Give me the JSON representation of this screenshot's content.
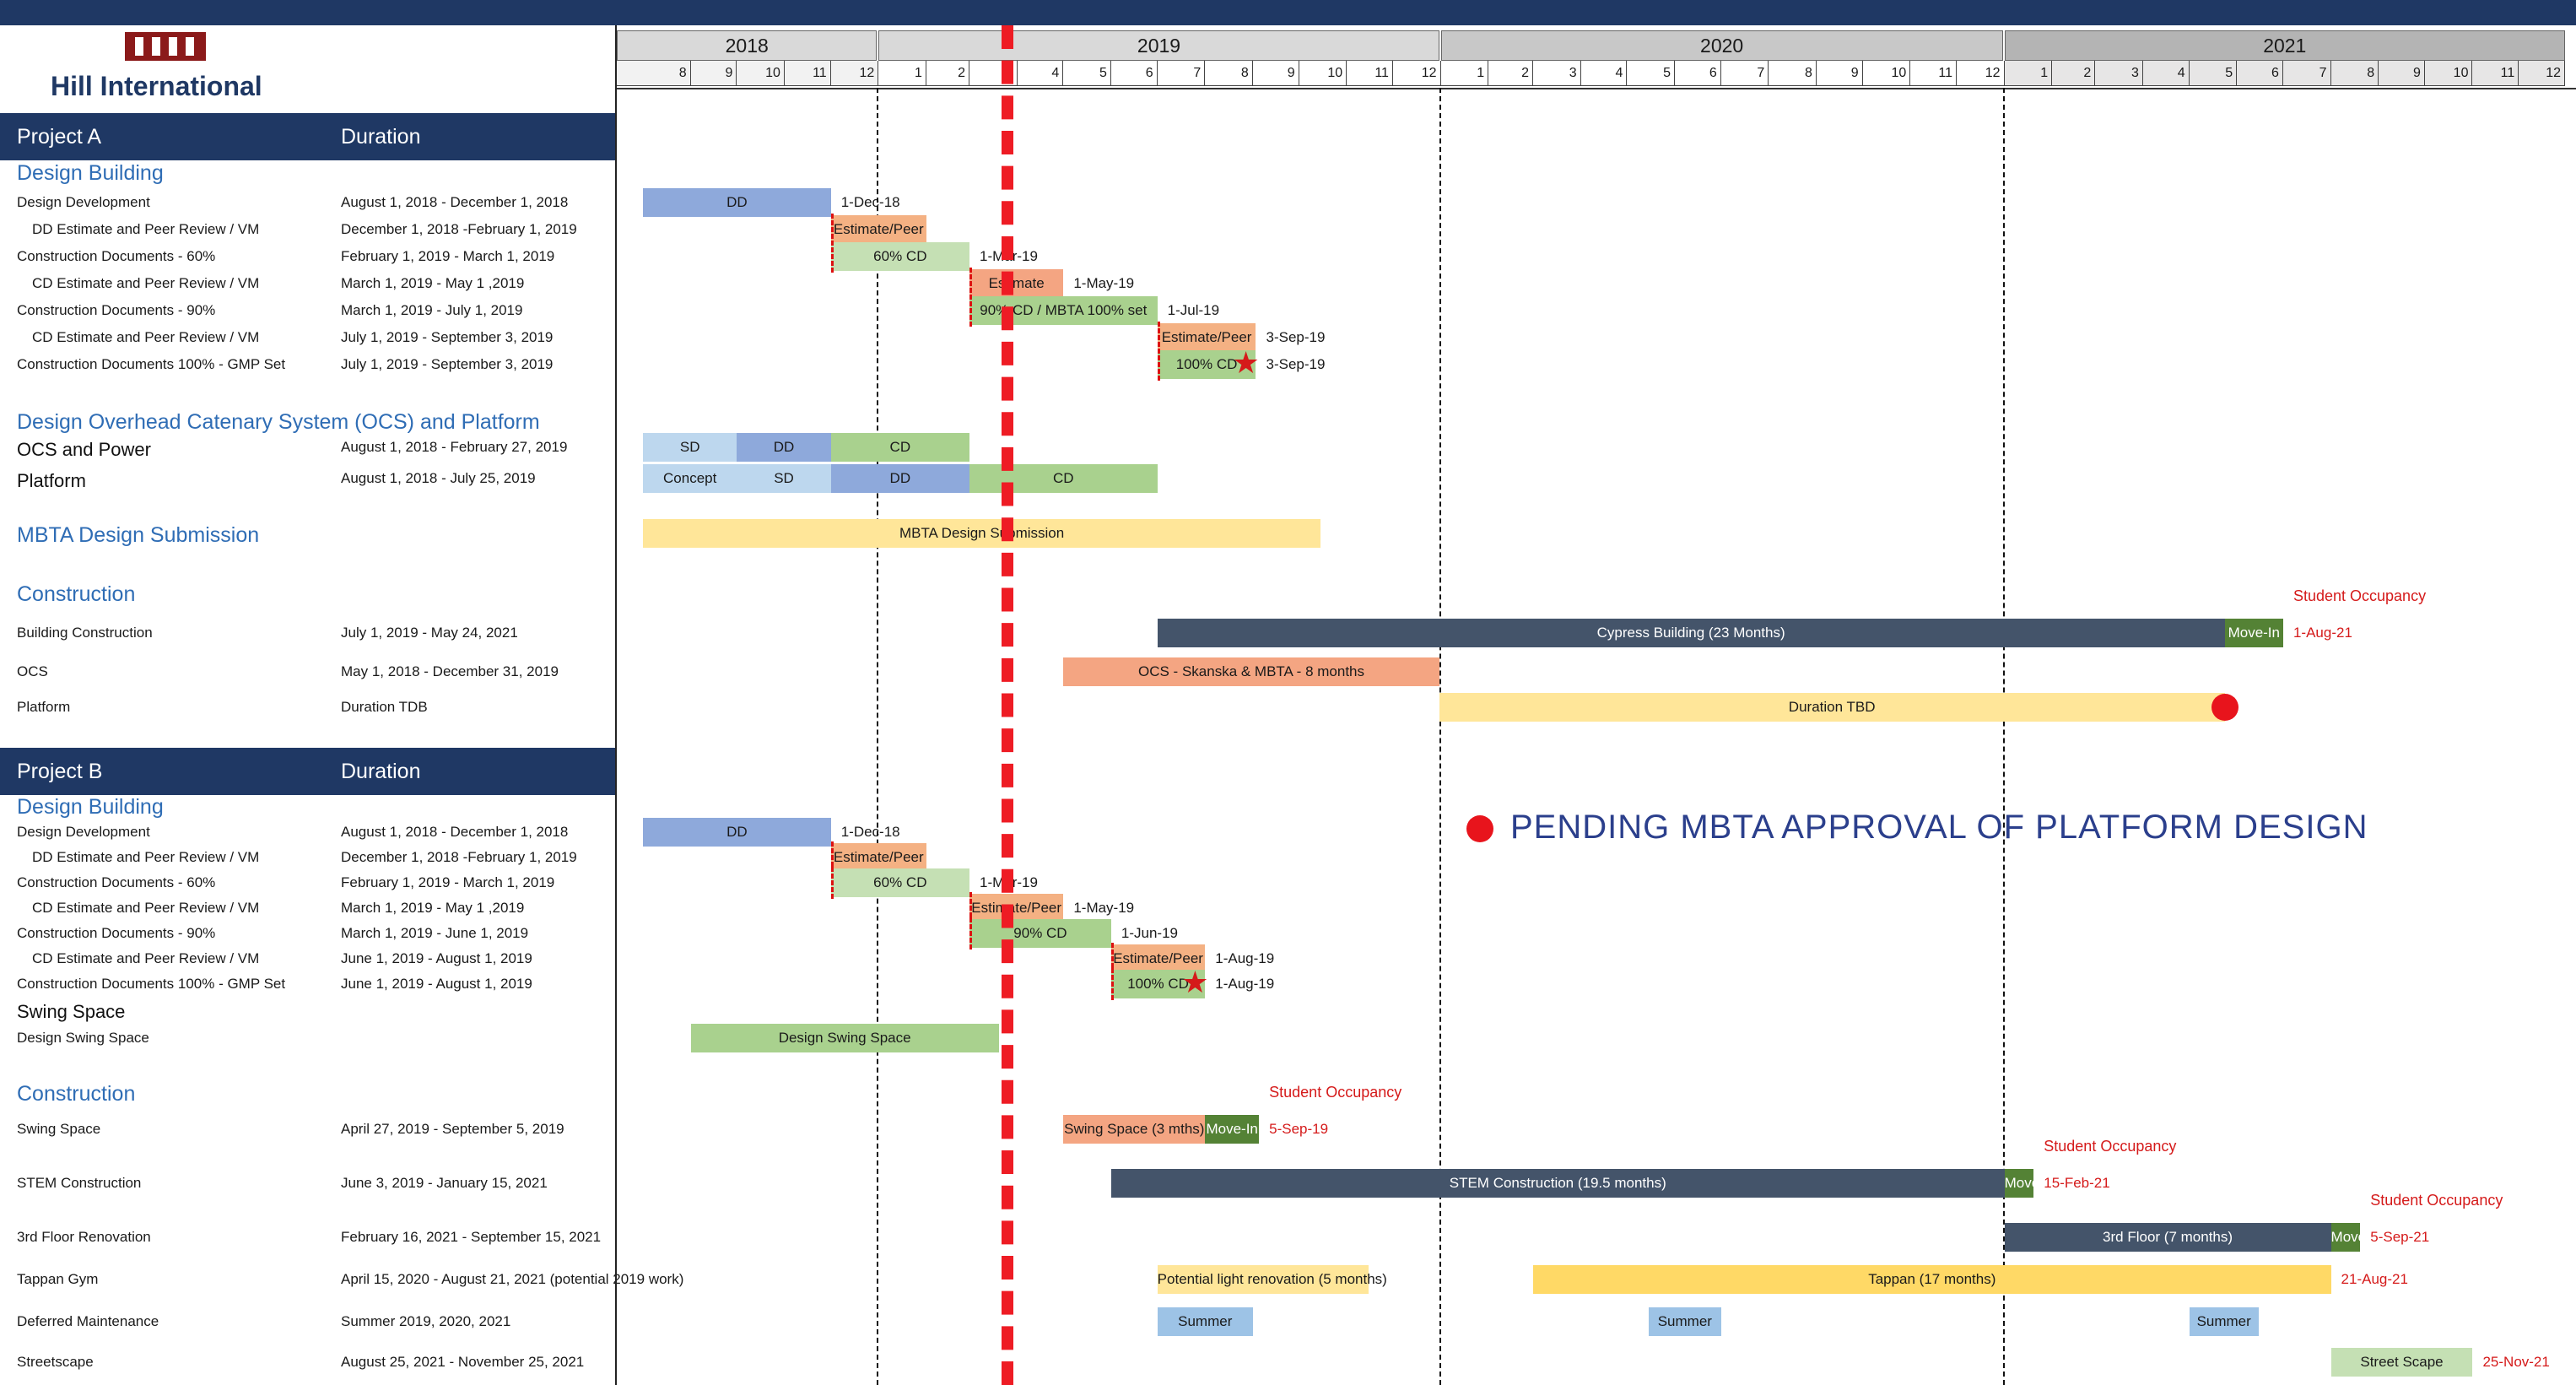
{
  "company": "Hill International",
  "logo_text": "HILL",
  "years": [
    "2018",
    "2019",
    "2020",
    "2021"
  ],
  "months": [
    "8",
    "9",
    "10",
    "11",
    "12",
    "1",
    "2",
    "3",
    "4",
    "5",
    "6",
    "7",
    "8",
    "9",
    "10",
    "11",
    "12",
    "1",
    "2",
    "3",
    "4",
    "5",
    "6",
    "7",
    "8",
    "9",
    "10",
    "11",
    "12",
    "1",
    "2",
    "3",
    "4",
    "5",
    "6",
    "7",
    "8",
    "9",
    "10",
    "11",
    "12"
  ],
  "colors": {
    "navy": "#1f3864",
    "accent_red": "#d51a1a",
    "blue_bar": "#8ea9db",
    "orange": "#f4b183",
    "green": "#a9d18e",
    "light_green": "#c5e0b4",
    "dark_green": "#548235",
    "slate": "#44546a",
    "gold": "#ffd966",
    "light_yellow": "#ffe699",
    "light_blue": "#bdd7ee",
    "sky": "#9dc3e6",
    "salmon": "#f4a582",
    "text_blue": "#2f6db5"
  },
  "pending_note": "PENDING MBTA APPROVAL OF PLATFORM DESIGN",
  "chart_data": {
    "type": "gantt",
    "time_axis": {
      "start": "2018-07-15",
      "end": "2021-12-31",
      "years": [
        "2018",
        "2019",
        "2020",
        "2021"
      ]
    },
    "today_marker": "2019-03-01",
    "project_a": {
      "header": "Project A",
      "duration_header": "Duration",
      "sections": [
        {
          "title": "Design Building",
          "rows": [
            {
              "label": "Design Development",
              "duration": "August 1, 2018 - December 1, 2018",
              "bars": [
                {
                  "label": "DD",
                  "start": "2018-08-01",
                  "end": "2018-12-01",
                  "color": "blue_bar"
                }
              ],
              "note": "1-Dec-18"
            },
            {
              "label": "DD Estimate and Peer Review / VM",
              "duration": "December 1, 2018 -February 1, 2019",
              "bars": [
                {
                  "label": "Estimate/Peer",
                  "start": "2018-12-01",
                  "end": "2019-02-01",
                  "color": "orange"
                }
              ]
            },
            {
              "label": "Construction Documents - 60%",
              "duration": "February 1, 2019 - March 1, 2019",
              "bars": [
                {
                  "label": "60%  CD",
                  "start": "2018-12-01",
                  "end": "2019-03-01",
                  "color": "light_green"
                }
              ],
              "note": "1-Mar-19"
            },
            {
              "label": "CD Estimate and Peer Review / VM",
              "duration": "March 1, 2019 - May 1 ,2019",
              "bars": [
                {
                  "label": "Estimate",
                  "start": "2019-03-01",
                  "end": "2019-05-01",
                  "color": "salmon"
                }
              ],
              "note": "1-May-19"
            },
            {
              "label": "Construction Documents - 90%",
              "duration": "March 1, 2019 - July 1, 2019",
              "bars": [
                {
                  "label": "90% CD / MBTA 100% set",
                  "start": "2019-03-01",
                  "end": "2019-07-01",
                  "color": "green"
                }
              ],
              "note": "1-Jul-19"
            },
            {
              "label": "CD Estimate and Peer Review / VM",
              "duration": "July 1, 2019 - September 3, 2019",
              "bars": [
                {
                  "label": "Estimate/Peer",
                  "start": "2019-07-01",
                  "end": "2019-09-03",
                  "color": "orange"
                }
              ],
              "note": "3-Sep-19"
            },
            {
              "label": "Construction Documents 100% - GMP Set",
              "duration": "July 1, 2019 - September 3, 2019",
              "bars": [
                {
                  "label": "100% CD",
                  "start": "2019-07-01",
                  "end": "2019-09-03",
                  "color": "green"
                }
              ],
              "note": "3-Sep-19"
            }
          ]
        },
        {
          "title": "Design Overhead Catenary System (OCS) and Platform",
          "rows": [
            {
              "label": "OCS and Power",
              "duration": "August 1, 2018 - February 27, 2019",
              "bars": [
                {
                  "label": "SD",
                  "start": "2018-08-01",
                  "end": "2018-10-01",
                  "color": "light_blue"
                },
                {
                  "label": "DD",
                  "start": "2018-10-01",
                  "end": "2018-12-01",
                  "color": "blue_bar"
                },
                {
                  "label": "CD",
                  "start": "2018-12-01",
                  "end": "2019-03-01",
                  "color": "green"
                }
              ]
            },
            {
              "label": "Platform",
              "duration": "August 1, 2018 - July 25, 2019",
              "bars": [
                {
                  "label": "Concept",
                  "start": "2018-08-01",
                  "end": "2018-10-01",
                  "color": "light_blue"
                },
                {
                  "label": "SD",
                  "start": "2018-10-01",
                  "end": "2018-12-01",
                  "color": "light_blue"
                },
                {
                  "label": "DD",
                  "start": "2018-12-01",
                  "end": "2019-03-01",
                  "color": "blue_bar"
                },
                {
                  "label": "CD",
                  "start": "2019-03-01",
                  "end": "2019-07-01",
                  "color": "green"
                }
              ]
            }
          ]
        },
        {
          "title": "MBTA Design Submission",
          "rows": [
            {
              "label": "",
              "duration": "",
              "bars": [
                {
                  "label": "MBTA Design Submission",
                  "start": "2018-08-01",
                  "end": "2019-10-15",
                  "color": "light_yellow"
                }
              ]
            }
          ]
        },
        {
          "title": "Construction",
          "rows": [
            {
              "label": "Building Construction",
              "duration": "July 1, 2019 - May 24, 2021",
              "bars": [
                {
                  "label": "Cypress Building (23 Months)",
                  "start": "2019-07-01",
                  "end": "2021-05-24",
                  "color": "slate"
                },
                {
                  "label": "Move-In",
                  "start": "2021-05-24",
                  "end": "2021-07-01",
                  "color": "dark_green"
                }
              ],
              "note_top": "Student Occupancy",
              "note": "1-Aug-21"
            },
            {
              "label": "OCS",
              "duration": "May 1, 2018 - December 31, 2019",
              "bars": [
                {
                  "label": "OCS - Skanska & MBTA - 8 months",
                  "start": "2019-05-01",
                  "end": "2019-12-31",
                  "color": "salmon"
                }
              ]
            },
            {
              "label": "Platform",
              "duration": "Duration TDB",
              "bars": [
                {
                  "label": "Duration TBD",
                  "start": "2019-12-31",
                  "end": "2021-05-24",
                  "color": "light_yellow"
                }
              ]
            }
          ]
        }
      ]
    },
    "project_b": {
      "header": "Project B",
      "duration_header": "Duration",
      "sections": [
        {
          "title": "Design Building",
          "rows": [
            {
              "label": "Design Development",
              "duration": "August 1, 2018 - December 1, 2018",
              "bars": [
                {
                  "label": "DD",
                  "start": "2018-08-01",
                  "end": "2018-12-01",
                  "color": "blue_bar"
                }
              ],
              "note": "1-Dec-18"
            },
            {
              "label": "DD Estimate and Peer Review / VM",
              "duration": "December 1, 2018 -February 1, 2019",
              "bars": [
                {
                  "label": "Estimate/Peer",
                  "start": "2018-12-01",
                  "end": "2019-02-01",
                  "color": "orange"
                }
              ]
            },
            {
              "label": "Construction Documents - 60%",
              "duration": "February 1, 2019 - March 1, 2019",
              "bars": [
                {
                  "label": "60%  CD",
                  "start": "2018-12-01",
                  "end": "2019-03-01",
                  "color": "light_green"
                }
              ],
              "note": "1-Mar-19"
            },
            {
              "label": "CD Estimate and Peer Review / VM",
              "duration": "March 1, 2019 - May 1 ,2019",
              "bars": [
                {
                  "label": "Estimate/Peer",
                  "start": "2019-03-01",
                  "end": "2019-05-01",
                  "color": "orange"
                }
              ],
              "note": "1-May-19"
            },
            {
              "label": "Construction Documents - 90%",
              "duration": "March 1, 2019 - June 1, 2019",
              "bars": [
                {
                  "label": "90% CD",
                  "start": "2019-03-01",
                  "end": "2019-06-01",
                  "color": "green"
                }
              ],
              "note": "1-Jun-19"
            },
            {
              "label": "CD Estimate and Peer Review / VM",
              "duration": "June  1, 2019 - August 1, 2019",
              "bars": [
                {
                  "label": "Estimate/Peer",
                  "start": "2019-06-01",
                  "end": "2019-08-01",
                  "color": "orange"
                }
              ],
              "note": "1-Aug-19"
            },
            {
              "label": "Construction Documents 100% - GMP Set",
              "duration": "June  1, 2019 - August 1, 2019",
              "bars": [
                {
                  "label": "100% CD",
                  "start": "2019-06-01",
                  "end": "2019-08-01",
                  "color": "green"
                }
              ],
              "note": "1-Aug-19"
            }
          ]
        },
        {
          "title": "Swing Space",
          "rows": [
            {
              "label": "Design Swing Space",
              "duration": "",
              "bars": [
                {
                  "label": "Design Swing Space",
                  "start": "2018-09-01",
                  "end": "2019-03-20",
                  "color": "green"
                }
              ]
            }
          ]
        },
        {
          "title": "Construction",
          "rows": [
            {
              "label": "Swing Space",
              "duration": "April 27, 2019 - September 5, 2019",
              "bars": [
                {
                  "label": "Swing Space (3 mths)",
                  "start": "2019-05-01",
                  "end": "2019-08-01",
                  "color": "salmon"
                },
                {
                  "label": "Move-In",
                  "start": "2019-08-01",
                  "end": "2019-09-05",
                  "color": "dark_green"
                }
              ],
              "note_top": "Student Occupancy",
              "note": "5-Sep-19"
            },
            {
              "label": "STEM Construction",
              "duration": "June 3, 2019 - January 15, 2021",
              "bars": [
                {
                  "label": "STEM Construction (19.5 months)",
                  "start": "2019-06-01",
                  "end": "2021-01-01",
                  "color": "slate"
                },
                {
                  "label": "Move-In",
                  "start": "2021-01-01",
                  "end": "2021-01-20",
                  "color": "dark_green"
                }
              ],
              "note_top": "Student Occupancy",
              "note": "15-Feb-21"
            },
            {
              "label": "3rd Floor Renovation",
              "duration": "February 16, 2021 - September 15, 2021",
              "bars": [
                {
                  "label": "3rd Floor (7 months)",
                  "start": "2021-01-01",
                  "end": "2021-08-01",
                  "color": "slate"
                },
                {
                  "label": "Move-In",
                  "start": "2021-08-01",
                  "end": "2021-08-20",
                  "color": "dark_green"
                }
              ],
              "note_top": "Student Occupancy",
              "note": "5-Sep-21"
            },
            {
              "label": "Tappan Gym",
              "duration": "April 15, 2020 - August 21, 2021 (potential 2019 work)",
              "bars": [
                {
                  "label": "Potential light renovation (5 months)",
                  "start": "2019-07-01",
                  "end": "2019-11-15",
                  "color": "light_yellow"
                },
                {
                  "label": "Tappan (17 months)",
                  "start": "2020-03-01",
                  "end": "2021-08-01",
                  "color": "gold"
                }
              ],
              "note": "21-Aug-21"
            },
            {
              "label": "Deferred Maintenance",
              "duration": "Summer 2019, 2020, 2021",
              "bars": [
                {
                  "label": "Summer",
                  "start": "2019-07-01",
                  "end": "2019-09-01",
                  "color": "sky"
                },
                {
                  "label": "Summer",
                  "start": "2020-05-15",
                  "end": "2020-07-01",
                  "color": "sky"
                },
                {
                  "label": "Summer",
                  "start": "2021-05-01",
                  "end": "2021-06-15",
                  "color": "sky"
                }
              ]
            },
            {
              "label": "Streetscape",
              "duration": "August 25, 2021 - November 25, 2021",
              "bars": [
                {
                  "label": "Street Scape",
                  "start": "2021-08-01",
                  "end": "2021-11-01",
                  "color": "light_green"
                }
              ],
              "note": "25-Nov-21"
            }
          ]
        }
      ]
    }
  }
}
